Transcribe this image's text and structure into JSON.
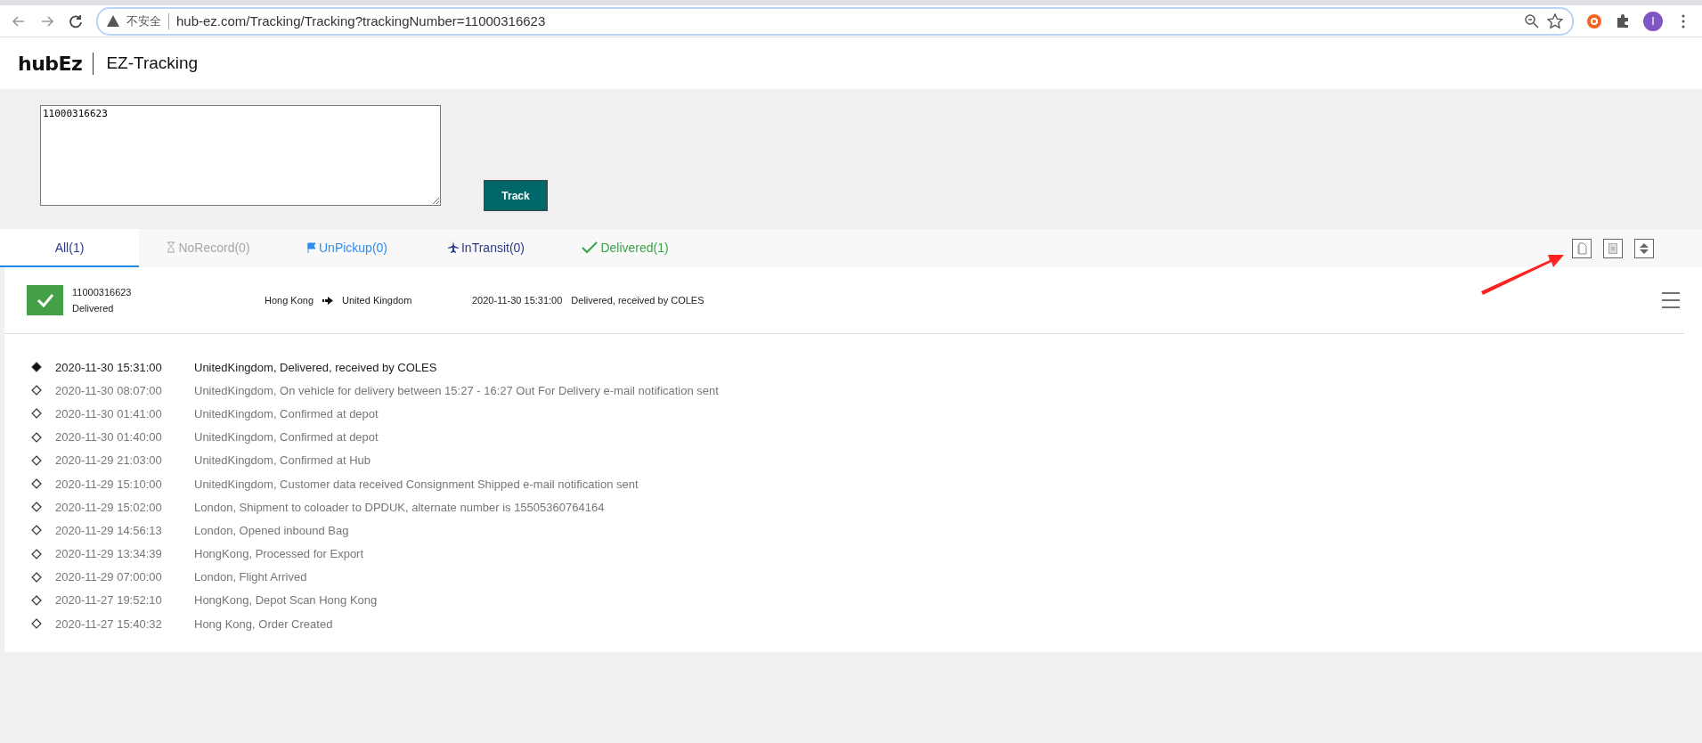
{
  "browser": {
    "security": "不安全",
    "url": "hub-ez.com/Tracking/Tracking?trackingNumber=11000316623",
    "profile_initial": "I"
  },
  "header": {
    "logo": "hubEz",
    "title": "EZ-Tracking"
  },
  "search": {
    "value": "11000316623",
    "button": "Track"
  },
  "tabs": [
    {
      "kind": "all",
      "label": "All(1)",
      "selected": true,
      "color": "#2b3a8c"
    },
    {
      "kind": "norecord",
      "label": "NoRecord(0)",
      "selected": false,
      "color": "#a6a6a6"
    },
    {
      "kind": "unpickup",
      "label": "UnPickup(0)",
      "selected": false,
      "color": "#2f8cf0"
    },
    {
      "kind": "intransit",
      "label": "InTransit(0)",
      "selected": false,
      "color": "#2b3a8c"
    },
    {
      "kind": "delivered",
      "label": "Delivered(1)",
      "selected": false,
      "color": "#3aa34a"
    }
  ],
  "shipment": {
    "number": "11000316623",
    "status": "Delivered",
    "origin": "Hong Kong",
    "destination": "United Kingdom",
    "time": "2020-11-30 15:31:00",
    "last_event": "Delivered, received by COLES"
  },
  "events": [
    {
      "time": "2020-11-30 15:31:00",
      "text": "UnitedKingdom, Delivered, received by COLES",
      "current": true
    },
    {
      "time": "2020-11-30 08:07:00",
      "text": "UnitedKingdom, On vehicle for delivery between 15:27 - 16:27 Out For Delivery e-mail notification sent",
      "current": false
    },
    {
      "time": "2020-11-30 01:41:00",
      "text": "UnitedKingdom, Confirmed at depot",
      "current": false
    },
    {
      "time": "2020-11-30 01:40:00",
      "text": "UnitedKingdom, Confirmed at depot",
      "current": false
    },
    {
      "time": "2020-11-29 21:03:00",
      "text": "UnitedKingdom, Confirmed at Hub",
      "current": false
    },
    {
      "time": "2020-11-29 15:10:00",
      "text": "UnitedKingdom, Customer data received Consignment Shipped e-mail notification sent",
      "current": false
    },
    {
      "time": "2020-11-29 15:02:00",
      "text": "London, Shipment to coloader to DPDUK, alternate number is 15505360764164",
      "current": false
    },
    {
      "time": "2020-11-29 14:56:13",
      "text": "London, Opened inbound Bag",
      "current": false
    },
    {
      "time": "2020-11-29 13:34:39",
      "text": "HongKong, Processed for Export",
      "current": false
    },
    {
      "time": "2020-11-29 07:00:00",
      "text": "London, Flight Arrived",
      "current": false
    },
    {
      "time": "2020-11-27 19:52:10",
      "text": "HongKong, Depot Scan Hong Kong",
      "current": false
    },
    {
      "time": "2020-11-27 15:40:32",
      "text": "Hong Kong, Order Created",
      "current": false
    }
  ]
}
